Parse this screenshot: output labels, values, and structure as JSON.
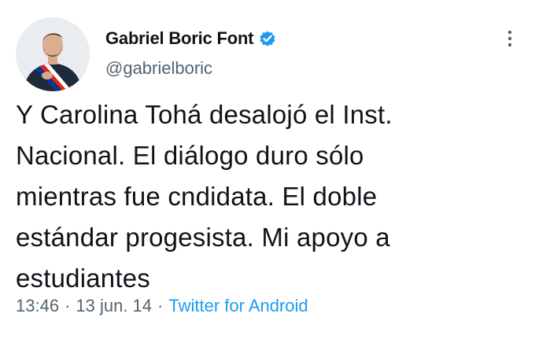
{
  "author": {
    "display_name": "Gabriel Boric Font",
    "handle": "@gabrielboric",
    "verified": true
  },
  "tweet": {
    "text": "Y Carolina Tohá desalojó el Inst.\nNacional. El diálogo duro sólo\nmientras fue cndidata. El doble\nestándar progesista. Mi apoyo a\nestudiantes"
  },
  "meta": {
    "time": "13:46",
    "separator": "·",
    "date": "13 jun. 14",
    "source": "Twitter for Android"
  },
  "icons": {
    "verified": "verified-badge-icon",
    "more": "more-options-icon"
  },
  "colors": {
    "text": "#0f1419",
    "secondary": "#536471",
    "accent": "#1d9bf0"
  }
}
